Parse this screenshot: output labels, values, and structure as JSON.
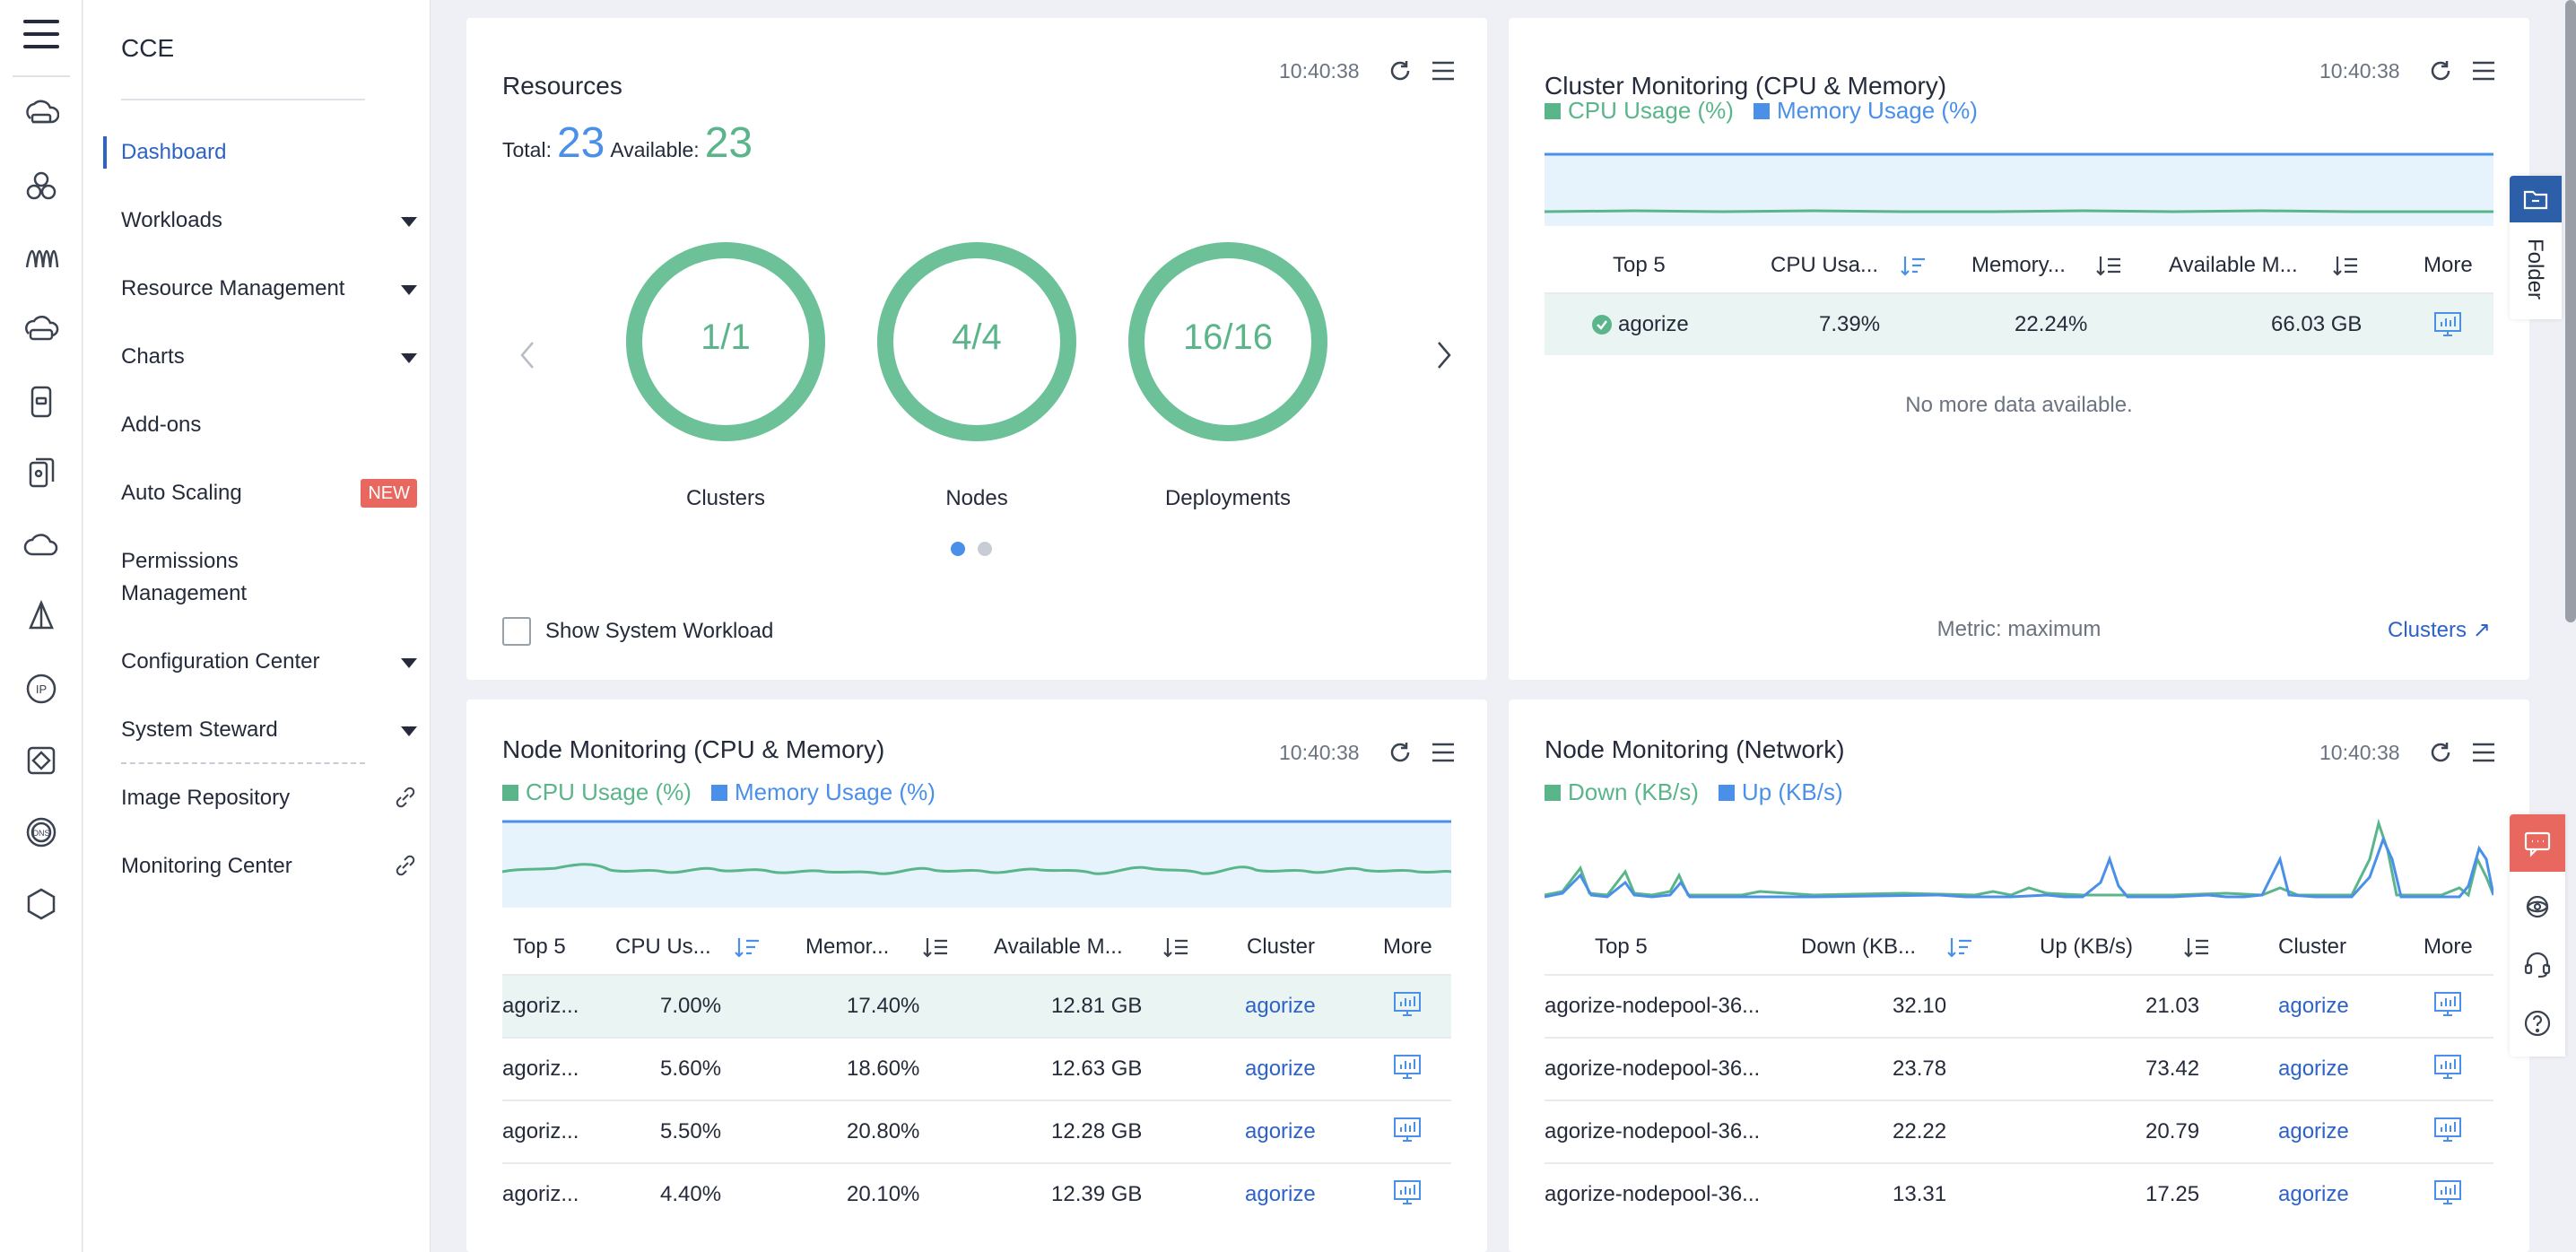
{
  "nav": {
    "service": "CCE",
    "items": [
      {
        "label": "Dashboard",
        "active": true
      },
      {
        "label": "Workloads",
        "expandable": true
      },
      {
        "label": "Resource Management",
        "expandable": true
      },
      {
        "label": "Charts",
        "expandable": true
      },
      {
        "label": "Add-ons"
      },
      {
        "label": "Auto Scaling",
        "badge": "NEW"
      },
      {
        "label": "Permissions",
        "label2": "Management"
      },
      {
        "label": "Configuration Center",
        "expandable": true
      },
      {
        "label": "System Steward",
        "expandable": true
      },
      {
        "label": "Image Repository",
        "external": true
      },
      {
        "label": "Monitoring Center",
        "external": true
      }
    ]
  },
  "resources": {
    "title": "Resources",
    "time": "10:40:38",
    "total_label": "Total:",
    "total": "23",
    "available_label": "Available:",
    "available": "23",
    "rings": [
      {
        "value": "1/1",
        "label": "Clusters"
      },
      {
        "value": "4/4",
        "label": "Nodes"
      },
      {
        "value": "16/16",
        "label": "Deployments"
      }
    ],
    "show_system_workload": "Show System Workload"
  },
  "cluster_monitoring": {
    "title": "Cluster Monitoring (CPU & Memory)",
    "time": "10:40:38",
    "legend": [
      {
        "label": "CPU Usage (%)",
        "color": "#5ab58a"
      },
      {
        "label": "Memory Usage (%)",
        "color": "#4a90e8"
      }
    ],
    "columns": [
      "Top 5",
      "CPU Usa...",
      "Memory...",
      "Available M...",
      "More"
    ],
    "rows": [
      {
        "name": "agorize",
        "cpu": "7.39%",
        "memory": "22.24%",
        "available": "66.03 GB"
      }
    ],
    "empty": "No more data available.",
    "metric": "Metric: maximum",
    "clusters_link": "Clusters"
  },
  "node_cpu": {
    "title": "Node Monitoring (CPU & Memory)",
    "time": "10:40:38",
    "legend": [
      {
        "label": "CPU Usage (%)",
        "color": "#5ab58a"
      },
      {
        "label": "Memory Usage (%)",
        "color": "#4a90e8"
      }
    ],
    "columns": [
      "Top 5",
      "CPU Us...",
      "Memor...",
      "Available M...",
      "Cluster",
      "More"
    ],
    "rows": [
      {
        "name": "agoriz...",
        "cpu": "7.00%",
        "memory": "17.40%",
        "available": "12.81 GB",
        "cluster": "agorize"
      },
      {
        "name": "agoriz...",
        "cpu": "5.60%",
        "memory": "18.60%",
        "available": "12.63 GB",
        "cluster": "agorize"
      },
      {
        "name": "agoriz...",
        "cpu": "5.50%",
        "memory": "20.80%",
        "available": "12.28 GB",
        "cluster": "agorize"
      },
      {
        "name": "agoriz...",
        "cpu": "4.40%",
        "memory": "20.10%",
        "available": "12.39 GB",
        "cluster": "agorize"
      }
    ]
  },
  "node_net": {
    "title": "Node Monitoring (Network)",
    "time": "10:40:38",
    "legend": [
      {
        "label": "Down (KB/s)",
        "color": "#5ab58a"
      },
      {
        "label": "Up (KB/s)",
        "color": "#4a90e8"
      }
    ],
    "columns": [
      "Top 5",
      "Down (KB...",
      "Up (KB/s)",
      "Cluster",
      "More"
    ],
    "rows": [
      {
        "name": "agorize-nodepool-36...",
        "down": "32.10",
        "up": "21.03",
        "cluster": "agorize"
      },
      {
        "name": "agorize-nodepool-36...",
        "down": "23.78",
        "up": "73.42",
        "cluster": "agorize"
      },
      {
        "name": "agorize-nodepool-36...",
        "down": "22.22",
        "up": "20.79",
        "cluster": "agorize"
      },
      {
        "name": "agorize-nodepool-36...",
        "down": "13.31",
        "up": "17.25",
        "cluster": "agorize"
      }
    ]
  },
  "folder": {
    "label": "Folder"
  },
  "icons": {
    "rail": [
      "menu-icon",
      "cloud-server-icon",
      "cluster-icon",
      "wave-icon",
      "disk-icon",
      "phone-icon",
      "stack-icon",
      "cloud-icon",
      "sail-icon",
      "ip-icon",
      "diamond-icon",
      "dns-icon",
      "hexagon-icon"
    ],
    "tools": [
      "chat-icon",
      "support-icon",
      "headset-icon",
      "help-icon"
    ]
  }
}
